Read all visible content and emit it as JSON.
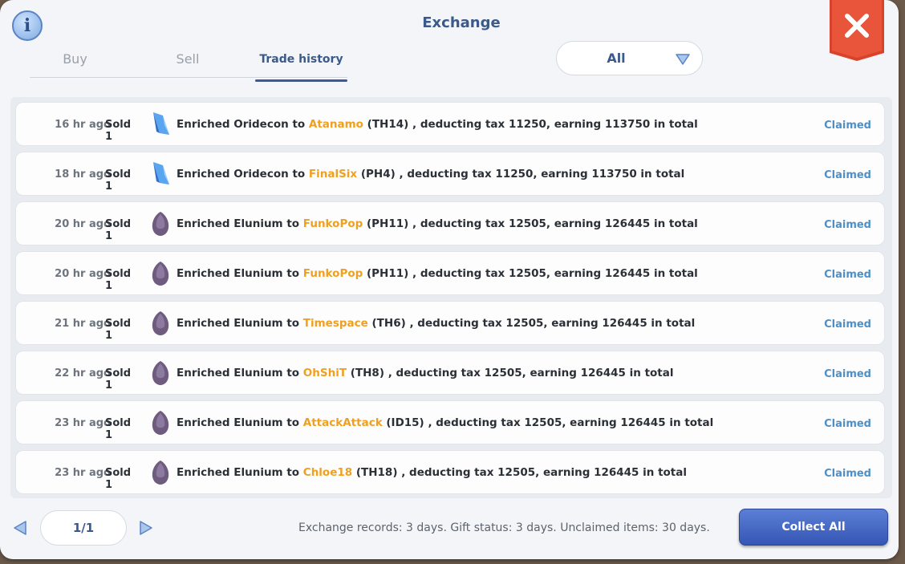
{
  "window": {
    "title": "Exchange"
  },
  "header": {
    "info_icon_text": "i"
  },
  "tabs": [
    {
      "label": "Buy",
      "active": false
    },
    {
      "label": "Sell",
      "active": false
    },
    {
      "label": "Trade history",
      "active": true
    }
  ],
  "filter": {
    "value": "All"
  },
  "records": [
    {
      "time": "16 hr ago",
      "qty": "Sold 1",
      "item": "Enriched Oridecon",
      "item_icon": "oridecon-crystal-icon",
      "to": "to",
      "player": "Atanamo",
      "server": "(TH14)",
      "detail": ", deducting tax 11250, earning 113750 in total",
      "status": "Claimed"
    },
    {
      "time": "18 hr ago",
      "qty": "Sold 1",
      "item": "Enriched Oridecon",
      "item_icon": "oridecon-crystal-icon",
      "to": "to",
      "player": "FinalSix",
      "server": "(PH4)",
      "detail": ", deducting tax 11250, earning 113750 in total",
      "status": "Claimed"
    },
    {
      "time": "20 hr ago",
      "qty": "Sold 1",
      "item": "Enriched Elunium",
      "item_icon": "elunium-stone-icon",
      "to": "to",
      "player": "FunkoPop",
      "server": "(PH11)",
      "detail": ", deducting tax 12505, earning 126445 in total",
      "status": "Claimed"
    },
    {
      "time": "20 hr ago",
      "qty": "Sold 1",
      "item": "Enriched Elunium",
      "item_icon": "elunium-stone-icon",
      "to": "to",
      "player": "FunkoPop",
      "server": "(PH11)",
      "detail": ", deducting tax 12505, earning 126445 in total",
      "status": "Claimed"
    },
    {
      "time": "21 hr ago",
      "qty": "Sold 1",
      "item": "Enriched Elunium",
      "item_icon": "elunium-stone-icon",
      "to": "to",
      "player": "Timespace",
      "server": "(TH6)",
      "detail": ", deducting tax 12505, earning 126445 in total",
      "status": "Claimed"
    },
    {
      "time": "22 hr ago",
      "qty": "Sold 1",
      "item": "Enriched Elunium",
      "item_icon": "elunium-stone-icon",
      "to": "to",
      "player": "OhShiT",
      "server": "(TH8)",
      "detail": ", deducting tax 12505, earning 126445 in total",
      "status": "Claimed"
    },
    {
      "time": "23 hr ago",
      "qty": "Sold 1",
      "item": "Enriched Elunium",
      "item_icon": "elunium-stone-icon",
      "to": "to",
      "player": "AttackAttack",
      "server": "(ID15)",
      "detail": ", deducting tax 12505, earning 126445 in total",
      "status": "Claimed"
    },
    {
      "time": "23 hr ago",
      "qty": "Sold 1",
      "item": "Enriched Elunium",
      "item_icon": "elunium-stone-icon",
      "to": "to",
      "player": "Chloe18",
      "server": "(TH18)",
      "detail": ", deducting tax 12505, earning 126445 in total",
      "status": "Claimed"
    }
  ],
  "pagination": {
    "page": "1/1"
  },
  "footer": {
    "note": "Exchange records: 3 days. Gift status: 3 days. Unclaimed items: 30 days.",
    "collect_label": "Collect All"
  },
  "colors": {
    "player_name": "#f0a020",
    "claimed": "#4e8fc6",
    "title": "#3a5a8c",
    "close_bg": "#e0482a",
    "collect_bg": "#3d60c0"
  }
}
